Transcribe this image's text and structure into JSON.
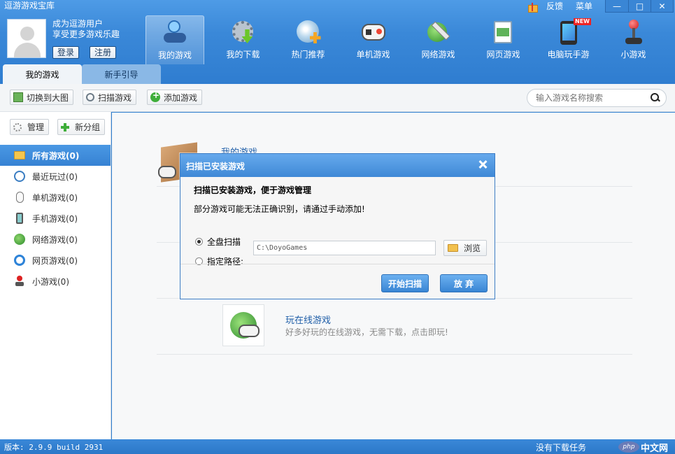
{
  "app": {
    "title": "逗游游戏宝库"
  },
  "topbar": {
    "feedback_label": "反馈",
    "menu_label": "菜单",
    "minimize": "—",
    "maximize": "□",
    "close": "✕"
  },
  "user": {
    "line1": "成为逗游用户",
    "line2": "享受更多游戏乐趣",
    "login_label": "登录",
    "register_label": "注册"
  },
  "nav": {
    "items": [
      {
        "label": "我的游戏",
        "icon": "my-games-icon"
      },
      {
        "label": "我的下载",
        "icon": "download-icon"
      },
      {
        "label": "热门推荐",
        "icon": "hot-recommend-icon"
      },
      {
        "label": "单机游戏",
        "icon": "gamepad-icon"
      },
      {
        "label": "网络游戏",
        "icon": "online-game-icon"
      },
      {
        "label": "网页游戏",
        "icon": "web-game-icon"
      },
      {
        "label": "电脑玩手游",
        "icon": "phone-game-icon",
        "badge": "NEW"
      },
      {
        "label": "小游戏",
        "icon": "joystick-icon"
      }
    ]
  },
  "tabs": [
    {
      "label": "我的游戏",
      "active": true
    },
    {
      "label": "新手引导",
      "active": false
    }
  ],
  "toolbar": {
    "switch_big_label": "切换到大图",
    "scan_label": "扫描游戏",
    "add_label": "添加游戏",
    "search_placeholder": "输入游戏名称搜索"
  },
  "sidebar": {
    "manage_label": "管理",
    "new_group_label": "新分组",
    "items": [
      {
        "label": "所有游戏(0)",
        "icon": "folder-icon",
        "active": true
      },
      {
        "label": "最近玩过(0)",
        "icon": "clock-icon",
        "active": false
      },
      {
        "label": "单机游戏(0)",
        "icon": "mouse-icon",
        "active": false
      },
      {
        "label": "手机游戏(0)",
        "icon": "mobile-icon",
        "active": false
      },
      {
        "label": "网络游戏(0)",
        "icon": "globe-icon",
        "active": false
      },
      {
        "label": "网页游戏(0)",
        "icon": "ie-icon",
        "active": false
      },
      {
        "label": "小游戏(0)",
        "icon": "joystick-icon",
        "active": false
      }
    ]
  },
  "main": {
    "my_games_title": "我的游戏",
    "online_title": "玩在线游戏",
    "online_desc": "好多好玩的在线游戏，无需下载，点击即玩!"
  },
  "dialog": {
    "title": "扫描已安装游戏",
    "heading": "扫描已安装游戏，便于游戏管理",
    "note": "部分游戏可能无法正确识别，请通过手动添加!",
    "option_full": "全盘扫描",
    "option_path": "指定路径:",
    "path_value": "C:\\DoyoGames",
    "browse_label": "浏览",
    "start_label": "开始扫描",
    "cancel_label": "放 弃",
    "selected_option": "全盘扫描"
  },
  "status": {
    "version": "版本: 2.9.9 build 2931",
    "download_status": "没有下载任务"
  },
  "watermark": {
    "logo_text": "php",
    "text": "中文网"
  },
  "colors": {
    "header_blue": "#3a88d8",
    "active_item_blue": "#3682d3",
    "link_blue": "#1f5ea8",
    "button_blue": "#3985d4"
  }
}
